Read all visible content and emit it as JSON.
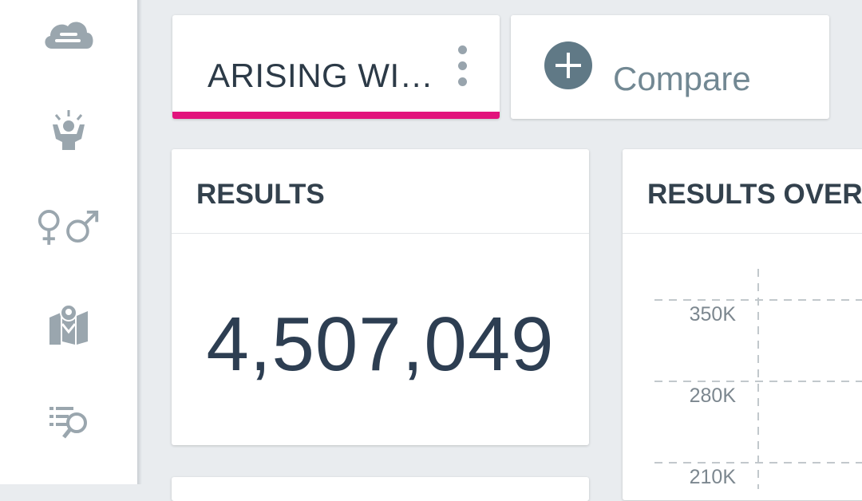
{
  "sidebar": {
    "items": [
      {
        "icon": "cloud-icon"
      },
      {
        "icon": "person-idea-icon"
      },
      {
        "icon": "gender-icon"
      },
      {
        "icon": "map-pin-icon"
      },
      {
        "icon": "list-search-icon"
      }
    ]
  },
  "tabs": {
    "active": {
      "title": "ARISING WI…",
      "accent": "#e2137c"
    },
    "compare": {
      "label": "Compare"
    }
  },
  "results_card": {
    "title": "RESULTS",
    "value": "4,507,049"
  },
  "over_time_card": {
    "title": "RESULTS OVER"
  },
  "chart_data": {
    "type": "line",
    "title": "RESULTS OVER",
    "y_tick_labels": [
      "350K",
      "280K",
      "210K"
    ],
    "y_ticks": [
      350000,
      280000,
      210000
    ],
    "grid": true,
    "series": []
  }
}
